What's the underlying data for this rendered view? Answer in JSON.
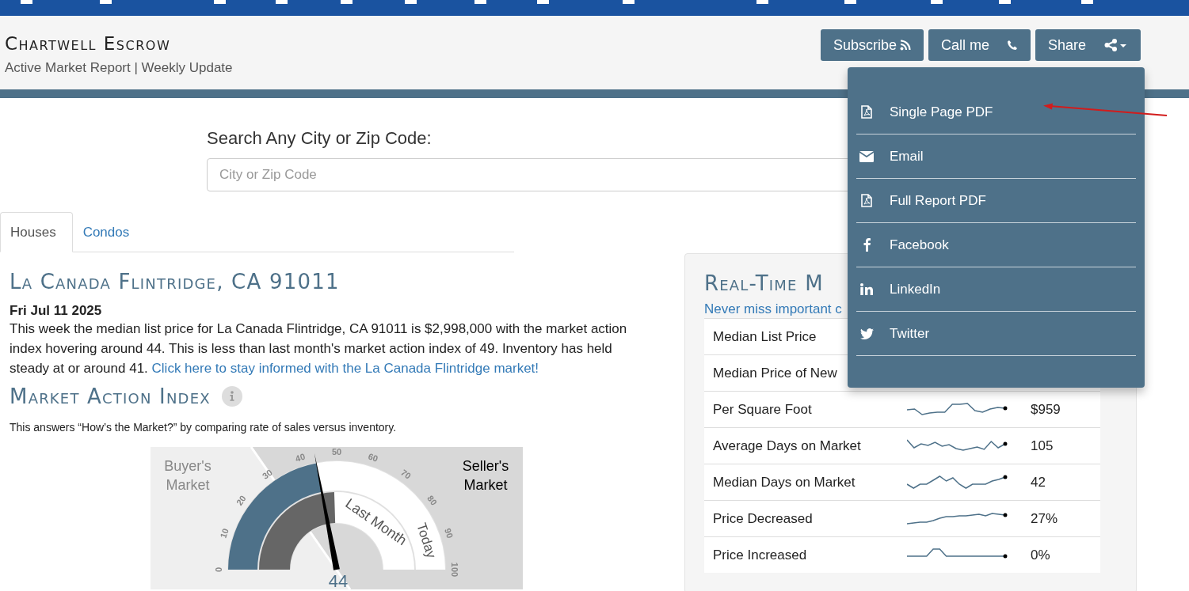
{
  "header": {
    "title": "Chartwell Escrow",
    "subtitle": "Active Market Report | Weekly Update",
    "buttons": [
      {
        "kind": "rss",
        "label": "Subscribe"
      },
      {
        "kind": "phone",
        "label": "Call me"
      },
      {
        "kind": "share",
        "label": "Share"
      }
    ]
  },
  "search": {
    "label": "Search Any City or Zip Code:",
    "placeholder": "City or Zip Code"
  },
  "tabs": [
    {
      "label": "Houses",
      "selected": true
    },
    {
      "label": "Condos",
      "selected": false
    }
  ],
  "report": {
    "title": "La Canada Flintridge, CA 91011",
    "date": "Fri Jul 11 2025",
    "summary": "This week the median list price for La Canada Flintridge, CA 91011 is $2,998,000 with the market action index hovering around 44. This is less than last month's market action index of 49. Inventory has held steady at or around 41. ",
    "link": "Click here to stay informed with the La Canada Flintridge market!"
  },
  "market_action": {
    "title": "Market Action Index",
    "description": "This answers “How’s the Market?” by comparing rate of sales versus inventory.",
    "gauge": {
      "buyers": "Buyer's Market",
      "sellers": "Seller's Market",
      "ticks": [
        "0",
        "10",
        "20",
        "30",
        "40",
        "50",
        "60",
        "70",
        "80",
        "90",
        "100"
      ],
      "arcs": [
        {
          "label": "Today",
          "level": 0.44
        },
        {
          "label": "Last Month",
          "level": 0.49
        }
      ],
      "value": "44"
    }
  },
  "panel": {
    "title": "Real-Time M",
    "subtitle": "Never miss important c",
    "rows": [
      {
        "label": "Median List Price"
      },
      {
        "label": "Median Price of New"
      },
      {
        "label": "Per Square Foot",
        "value": "$959"
      },
      {
        "label": "Average Days on Market",
        "value": "105"
      },
      {
        "label": "Median Days on Market",
        "value": "42"
      },
      {
        "label": "Price Decreased",
        "value": "27%"
      },
      {
        "label": "Price Increased",
        "value": "0%"
      }
    ]
  },
  "share_menu": {
    "items": [
      {
        "kind": "pdf",
        "label": "Single Page PDF"
      },
      {
        "kind": "email",
        "label": "Email"
      },
      {
        "kind": "pdf",
        "label": "Full Report PDF"
      },
      {
        "kind": "facebook",
        "label": "Facebook"
      },
      {
        "kind": "linkedin",
        "label": "LinkedIn"
      },
      {
        "kind": "twitter",
        "label": "Twitter"
      }
    ]
  }
}
